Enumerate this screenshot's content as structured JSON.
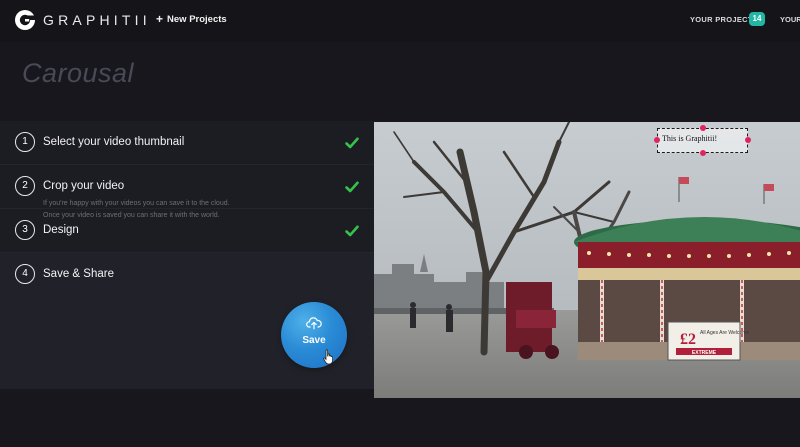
{
  "app": {
    "brand": "GRAPHITII",
    "new_projects_label": "New Projects",
    "your_projects_label": "YOUR PROJECTS",
    "projects_count": "14",
    "cut_label": "YOUR"
  },
  "page": {
    "title": "Carousal"
  },
  "steps": [
    {
      "number": "1",
      "label": "Select your video thumbnail",
      "completed": true
    },
    {
      "number": "2",
      "label": "Crop your video",
      "completed": true
    },
    {
      "number": "3",
      "label": "Design",
      "completed": true
    },
    {
      "number": "4",
      "label": "Save & Share",
      "completed": false
    }
  ],
  "save_share": {
    "description": "If you're happy with your videos you can save it to the cloud. Once your video is saved you can share it with the world.",
    "save_button_label": "Save"
  },
  "video": {
    "overlay_text": "This is Graphitii!",
    "sign_price": "£2",
    "sign_text": "All Ages Are Welcome",
    "sign_banner": "EXTREME"
  },
  "colors": {
    "accent_teal": "#22b6a4",
    "check_green": "#36c24a",
    "save_blue": "#2a8bd6",
    "handle_pink": "#e0245e"
  },
  "icons": {
    "logo": "graphitii-logo-icon",
    "plus": "plus-icon",
    "check": "checkmark-icon",
    "upload": "cloud-upload-icon",
    "cursor": "hand-pointer-icon"
  }
}
